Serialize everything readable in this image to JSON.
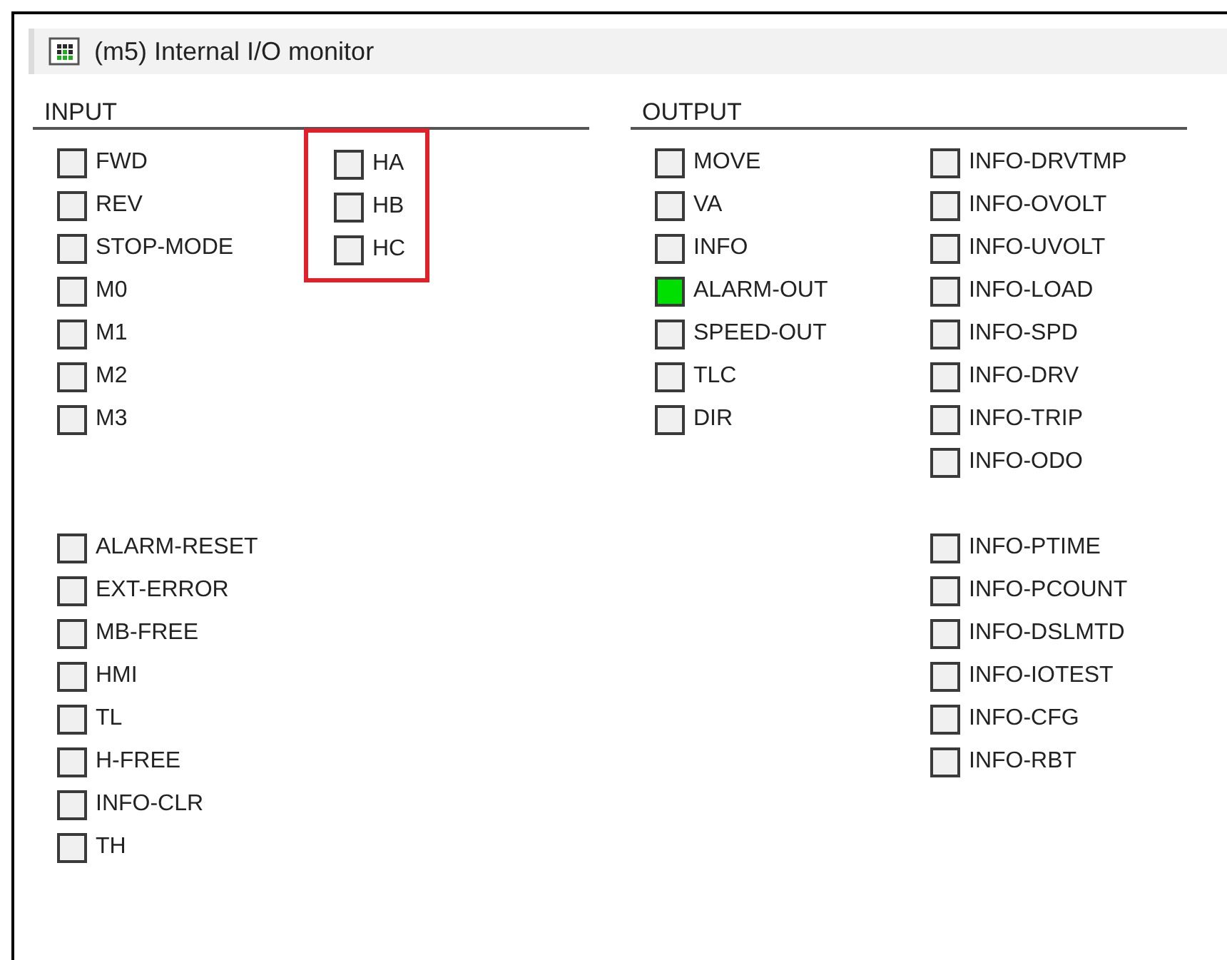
{
  "window": {
    "title": "(m5) Internal I/O monitor"
  },
  "sections": [
    {
      "heading": "INPUT",
      "columns": [
        {
          "groups": [
            {
              "highlighted": false,
              "items": [
                {
                  "label": "FWD",
                  "on": false
                },
                {
                  "label": "REV",
                  "on": false
                },
                {
                  "label": "STOP-MODE",
                  "on": false
                },
                {
                  "label": "M0",
                  "on": false
                },
                {
                  "label": "M1",
                  "on": false
                },
                {
                  "label": "M2",
                  "on": false
                },
                {
                  "label": "M3",
                  "on": false
                }
              ]
            },
            {
              "highlighted": false,
              "items": [
                {
                  "label": "ALARM-RESET",
                  "on": false
                },
                {
                  "label": "EXT-ERROR",
                  "on": false
                },
                {
                  "label": "MB-FREE",
                  "on": false
                },
                {
                  "label": "HMI",
                  "on": false
                },
                {
                  "label": "TL",
                  "on": false
                },
                {
                  "label": "H-FREE",
                  "on": false
                },
                {
                  "label": "INFO-CLR",
                  "on": false
                },
                {
                  "label": "TH",
                  "on": false
                }
              ]
            }
          ]
        },
        {
          "groups": [
            {
              "highlighted": true,
              "items": [
                {
                  "label": "HA",
                  "on": false
                },
                {
                  "label": "HB",
                  "on": false
                },
                {
                  "label": "HC",
                  "on": false
                }
              ]
            }
          ]
        }
      ]
    },
    {
      "heading": "OUTPUT",
      "columns": [
        {
          "groups": [
            {
              "highlighted": false,
              "items": [
                {
                  "label": "MOVE",
                  "on": false
                },
                {
                  "label": "VA",
                  "on": false
                },
                {
                  "label": "INFO",
                  "on": false
                },
                {
                  "label": "ALARM-OUT",
                  "on": true
                },
                {
                  "label": "SPEED-OUT",
                  "on": false
                },
                {
                  "label": "TLC",
                  "on": false
                },
                {
                  "label": "DIR",
                  "on": false
                }
              ]
            }
          ]
        },
        {
          "groups": [
            {
              "highlighted": false,
              "items": [
                {
                  "label": "INFO-DRVTMP",
                  "on": false
                },
                {
                  "label": "INFO-OVOLT",
                  "on": false
                },
                {
                  "label": "INFO-UVOLT",
                  "on": false
                },
                {
                  "label": "INFO-LOAD",
                  "on": false
                },
                {
                  "label": "INFO-SPD",
                  "on": false
                },
                {
                  "label": "INFO-DRV",
                  "on": false
                },
                {
                  "label": "INFO-TRIP",
                  "on": false
                },
                {
                  "label": "INFO-ODO",
                  "on": false
                }
              ]
            },
            {
              "highlighted": false,
              "items": [
                {
                  "label": "INFO-PTIME",
                  "on": false
                },
                {
                  "label": "INFO-PCOUNT",
                  "on": false
                },
                {
                  "label": "INFO-DSLMTD",
                  "on": false
                },
                {
                  "label": "INFO-IOTEST",
                  "on": false
                },
                {
                  "label": "INFO-CFG",
                  "on": false
                },
                {
                  "label": "INFO-RBT",
                  "on": false
                }
              ]
            }
          ]
        }
      ]
    }
  ]
}
